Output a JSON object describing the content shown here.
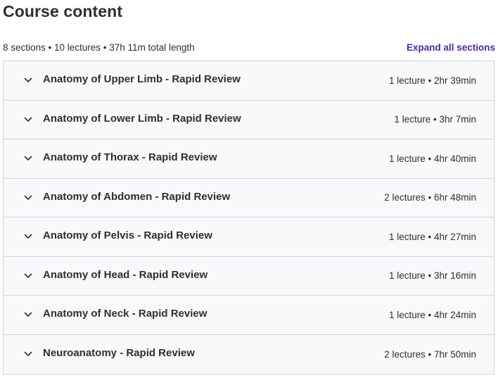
{
  "header": {
    "title": "Course content",
    "summary": "8 sections • 10 lectures • 37h 11m total length",
    "expand_label": "Expand all sections"
  },
  "colors": {
    "accent": "#5022c3",
    "section_bg": "#f7f9fa",
    "border": "#d1d7dc",
    "text": "#2d2f31"
  },
  "sections": [
    {
      "title": "Anatomy of Upper Limb - Rapid Review",
      "meta": "1 lecture • 2hr 39min",
      "icon": "chevron-down-icon"
    },
    {
      "title": "Anatomy of Lower Limb - Rapid Review",
      "meta": "1 lecture • 3hr 7min",
      "icon": "chevron-down-icon"
    },
    {
      "title": "Anatomy of Thorax - Rapid Review",
      "meta": "1 lecture • 4hr 40min",
      "icon": "chevron-down-icon"
    },
    {
      "title": "Anatomy of Abdomen - Rapid Review",
      "meta": "2 lectures • 6hr 48min",
      "icon": "chevron-down-icon"
    },
    {
      "title": "Anatomy of Pelvis - Rapid Review",
      "meta": "1 lecture • 4hr 27min",
      "icon": "chevron-down-icon"
    },
    {
      "title": "Anatomy of Head - Rapid Review",
      "meta": "1 lecture • 3hr 16min",
      "icon": "chevron-down-icon"
    },
    {
      "title": "Anatomy of Neck - Rapid Review",
      "meta": "1 lecture • 4hr 24min",
      "icon": "chevron-down-icon"
    },
    {
      "title": "Neuroanatomy - Rapid Review",
      "meta": "2 lectures • 7hr 50min",
      "icon": "chevron-down-icon"
    }
  ]
}
